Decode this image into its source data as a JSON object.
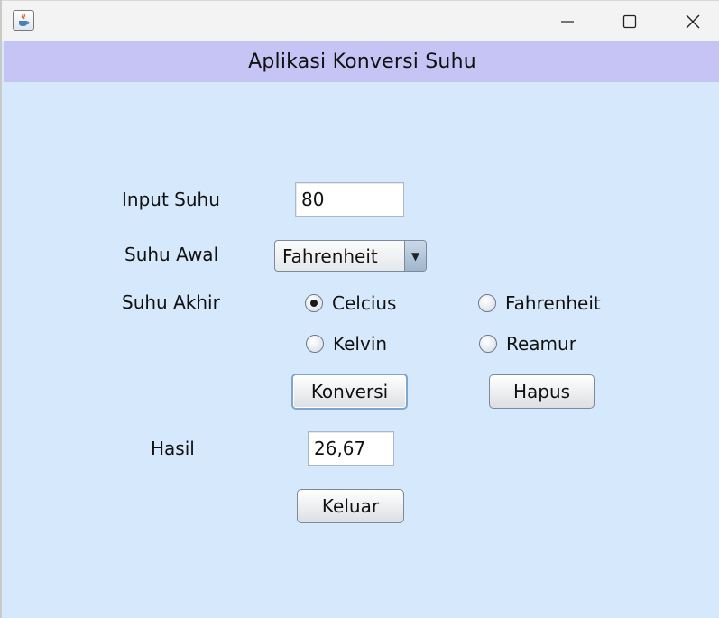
{
  "window": {
    "title_bar": {
      "app_icon": "java-cup-icon",
      "minimize_icon": "minimize-icon",
      "maximize_icon": "maximize-icon",
      "close_icon": "close-icon"
    },
    "header_title": "Aplikasi Konversi Suhu",
    "header_color": "#c6c4f5",
    "background_color": "#d6e8fb"
  },
  "form": {
    "input_label": "Input Suhu",
    "input_value": "80",
    "source_label": "Suhu Awal",
    "source_selected": "Fahrenheit",
    "target_label": "Suhu Akhir",
    "target_options": [
      {
        "label": "Celcius",
        "selected": true
      },
      {
        "label": "Fahrenheit",
        "selected": false
      },
      {
        "label": "Kelvin",
        "selected": false
      },
      {
        "label": "Reamur",
        "selected": false
      }
    ],
    "convert_label": "Konversi",
    "clear_label": "Hapus",
    "result_label": "Hasil",
    "result_value": "26,67",
    "exit_label": "Keluar"
  }
}
